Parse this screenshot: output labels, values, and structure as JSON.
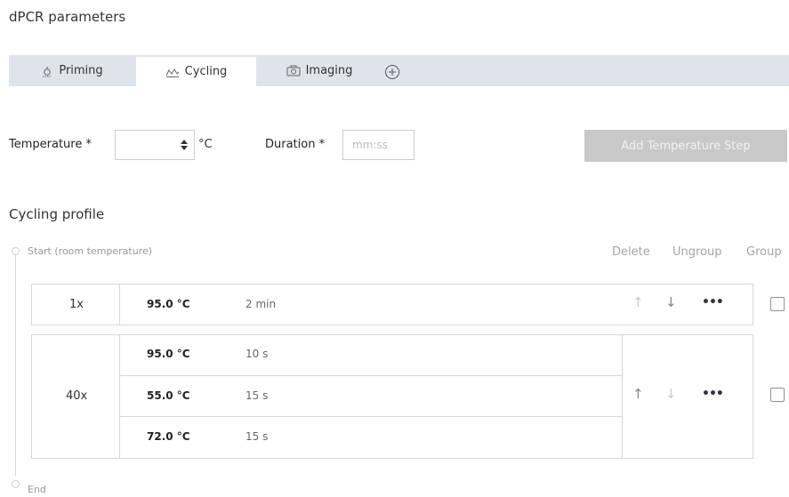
{
  "page": {
    "title": "dPCR parameters"
  },
  "tabs": [
    {
      "label": "Priming",
      "icon": "thermometer-icon"
    },
    {
      "label": "Cycling",
      "icon": "cycling-wave-icon"
    },
    {
      "label": "Imaging",
      "icon": "camera-icon"
    }
  ],
  "form": {
    "temperature_label": "Temperature *",
    "temperature_value": "",
    "temperature_unit": "°C",
    "duration_label": "Duration *",
    "duration_placeholder": "mm:ss",
    "add_step_label": "Add Temperature Step"
  },
  "profile": {
    "title": "Cycling profile",
    "start_label": "Start (room temperature)",
    "end_label": "End",
    "actions": {
      "delete": "Delete",
      "ungroup": "Ungroup",
      "group": "Group"
    },
    "groups": [
      {
        "repeat": "1x",
        "steps": [
          {
            "temp": "95.0 °C",
            "duration": "2 min"
          }
        ]
      },
      {
        "repeat": "40x",
        "steps": [
          {
            "temp": "95.0 °C",
            "duration": "10 s"
          },
          {
            "temp": "55.0 °C",
            "duration": "15 s"
          },
          {
            "temp": "72.0 °C",
            "duration": "15 s"
          }
        ]
      }
    ]
  },
  "icons": {
    "up": "↑",
    "down": "↓",
    "more": "•••"
  },
  "colors": {
    "tab_bar": "#dfe4ea",
    "button_disabled": "#c8c8c8"
  }
}
